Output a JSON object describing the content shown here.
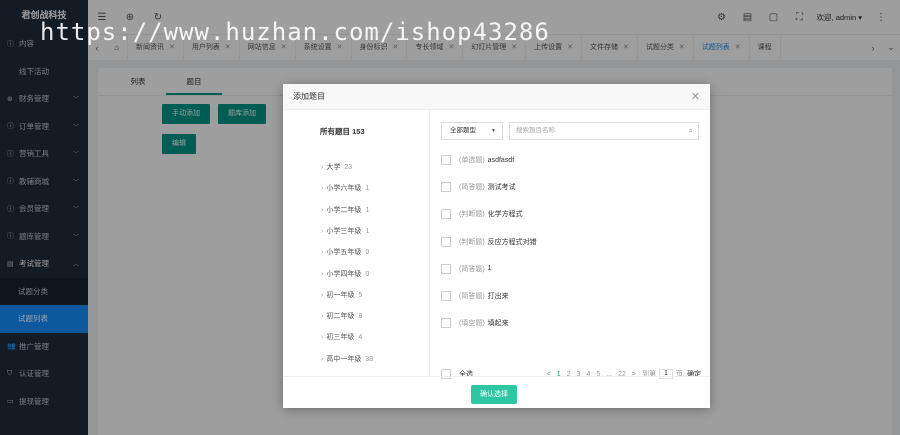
{
  "brand": "君创战科技",
  "sidebar": {
    "items": [
      {
        "icon": "circle-info-icon",
        "label": "内容"
      },
      {
        "icon": "none",
        "label": "线下活动"
      },
      {
        "icon": "circle-yen-icon",
        "label": "财务管理"
      },
      {
        "icon": "circle-info-icon",
        "label": "订单管理"
      },
      {
        "icon": "circle-info-icon",
        "label": "营销工具"
      },
      {
        "icon": "circle-info-icon",
        "label": "教辅商城"
      },
      {
        "icon": "circle-info-icon",
        "label": "会员管理"
      },
      {
        "icon": "circle-info-icon",
        "label": "题库管理"
      },
      {
        "icon": "document-icon",
        "label": "考试管理"
      }
    ],
    "exam_sub": [
      {
        "label": "试题分类"
      },
      {
        "label": "试题列表"
      }
    ],
    "bottom": [
      {
        "icon": "user-group-icon",
        "label": "推广管理"
      },
      {
        "icon": "shield-icon",
        "label": "认证管理"
      },
      {
        "icon": "card-icon",
        "label": "提现管理"
      }
    ]
  },
  "header": {
    "welcome": "欢迎, admin"
  },
  "tabs": [
    {
      "label": "新闻资讯"
    },
    {
      "label": "用户列表"
    },
    {
      "label": "网站信息"
    },
    {
      "label": "系统设置"
    },
    {
      "label": "身份标识"
    },
    {
      "label": "专长领域"
    },
    {
      "label": "幻灯片管理"
    },
    {
      "label": "上传设置"
    },
    {
      "label": "文件存储"
    },
    {
      "label": "试题分类"
    },
    {
      "label": "试题列表"
    },
    {
      "label": "课程"
    }
  ],
  "content": {
    "tabs": [
      "列表",
      "题目"
    ],
    "buttons": {
      "manual_add": "手动添加",
      "bank_add": "题库添加",
      "edit": "编辑"
    }
  },
  "modal": {
    "title": "添加题目",
    "tree_title": "所有题目 153",
    "tree": [
      {
        "label": "大学",
        "count": "23"
      },
      {
        "label": "小学六年级",
        "count": "1"
      },
      {
        "label": "小学二年级",
        "count": "1"
      },
      {
        "label": "小学三年级",
        "count": "1"
      },
      {
        "label": "小学五年级",
        "count": "0"
      },
      {
        "label": "小学四年级",
        "count": "0"
      },
      {
        "label": "初一年级",
        "count": "5"
      },
      {
        "label": "初二年级",
        "count": "8"
      },
      {
        "label": "初三年级",
        "count": "4"
      },
      {
        "label": "高中一年级",
        "count": "38"
      }
    ],
    "filter_type": "全部题型",
    "search_placeholder": "搜索题目名称",
    "questions": [
      {
        "type": "(单选题)",
        "text": "asdfasdf"
      },
      {
        "type": "(简答题)",
        "text": "测试考试"
      },
      {
        "type": "(判断题)",
        "text": "化学方程式"
      },
      {
        "type": "(判断题)",
        "text": "反应方程式对错"
      },
      {
        "type": "(简答题)",
        "text": "1"
      },
      {
        "type": "(简答题)",
        "text": "打出来"
      },
      {
        "type": "(填空题)",
        "text": "填起来"
      }
    ],
    "select_all": "全选",
    "pager": {
      "prev": "<",
      "pages": [
        "1",
        "2",
        "3",
        "4",
        "5",
        "...",
        "22"
      ],
      "current": "1",
      "next": ">",
      "goto": "到第",
      "jump_value": "1",
      "page_unit": "页",
      "ok": "确定"
    },
    "confirm": "确认选择"
  },
  "watermark": "https://www.huzhan.com/ishop43286"
}
